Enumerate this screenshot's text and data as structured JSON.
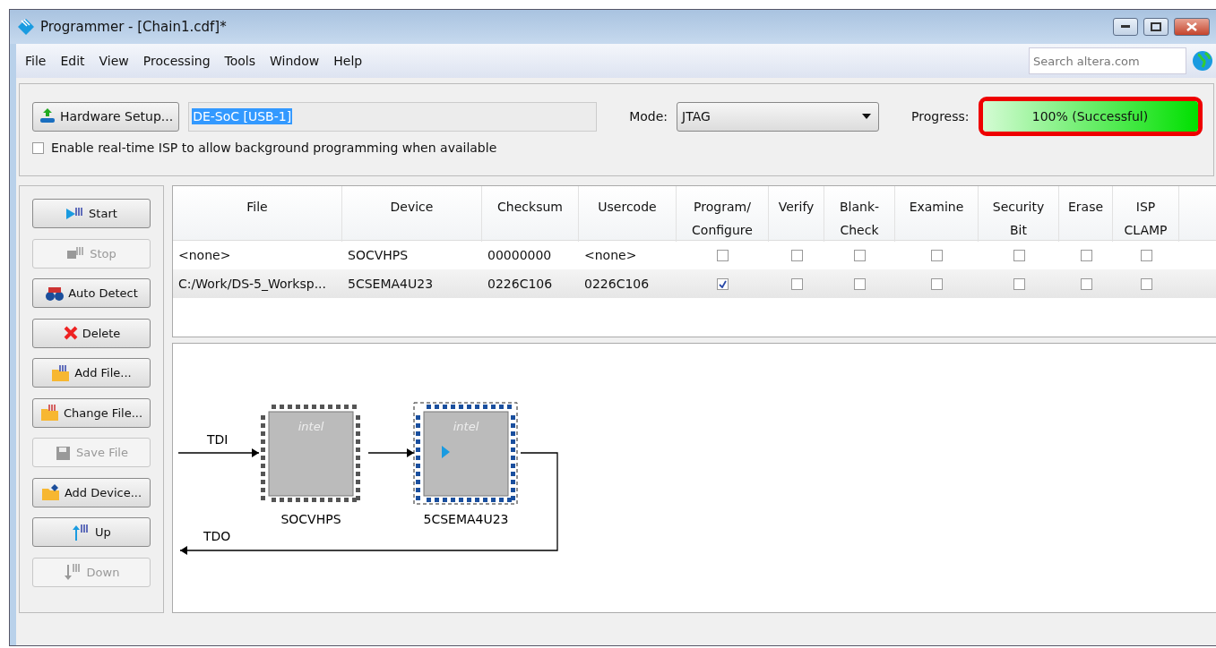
{
  "window": {
    "title": "Programmer - [Chain1.cdf]*"
  },
  "menu": [
    {
      "label": "File"
    },
    {
      "label": "Edit"
    },
    {
      "label": "View"
    },
    {
      "label": "Processing"
    },
    {
      "label": "Tools"
    },
    {
      "label": "Window"
    },
    {
      "label": "Help"
    }
  ],
  "search": {
    "placeholder": "Search altera.com"
  },
  "hardware": {
    "button": "Hardware Setup...",
    "value": "DE-SoC [USB-1]"
  },
  "mode": {
    "label": "Mode:",
    "value": "JTAG"
  },
  "progress": {
    "label": "Progress:",
    "text": "100% (Successful)",
    "level": 1
  },
  "isp_option": {
    "label": "Enable real-time ISP to allow background programming when available",
    "checked": false
  },
  "actions": [
    {
      "label": "Start",
      "kind": "start",
      "disabled": false
    },
    {
      "label": "Stop",
      "kind": "stop",
      "disabled": true
    },
    {
      "label": "Auto Detect",
      "kind": "detect",
      "disabled": false
    },
    {
      "label": "Delete",
      "kind": "delete",
      "disabled": false
    },
    {
      "label": "Add File...",
      "kind": "addfile",
      "disabled": false
    },
    {
      "label": "Change File...",
      "kind": "changefile",
      "disabled": false
    },
    {
      "label": "Save File",
      "kind": "save",
      "disabled": true
    },
    {
      "label": "Add Device...",
      "kind": "adddevice",
      "disabled": false
    },
    {
      "label": "Up",
      "kind": "up",
      "disabled": false
    },
    {
      "label": "Down",
      "kind": "down",
      "disabled": true
    }
  ],
  "table": {
    "columns": [
      "File",
      "Device",
      "Checksum",
      "Usercode",
      "Program/ Configure",
      "Verify",
      "Blank- Check",
      "Examine",
      "Security Bit",
      "Erase",
      "ISP CLAMP"
    ],
    "rows": [
      {
        "file": "<none>",
        "device": "SOCVHPS",
        "checksum": "00000000",
        "usercode": "<none>",
        "selected": false,
        "options": [
          false,
          false,
          false,
          false,
          false,
          false,
          false
        ]
      },
      {
        "file": "C:/Work/DS-5_Worksp...",
        "device": "5CSEMA4U23",
        "checksum": "0226C106",
        "usercode": "0226C106",
        "selected": true,
        "options": [
          true,
          false,
          false,
          false,
          false,
          false,
          false
        ]
      }
    ]
  },
  "chain": {
    "tdi": "TDI",
    "tdo": "TDO",
    "devices": [
      {
        "name": "SOCVHPS",
        "logo": "intel",
        "selected": false
      },
      {
        "name": "5CSEMA4U23",
        "logo": "intel",
        "selected": true
      }
    ]
  }
}
